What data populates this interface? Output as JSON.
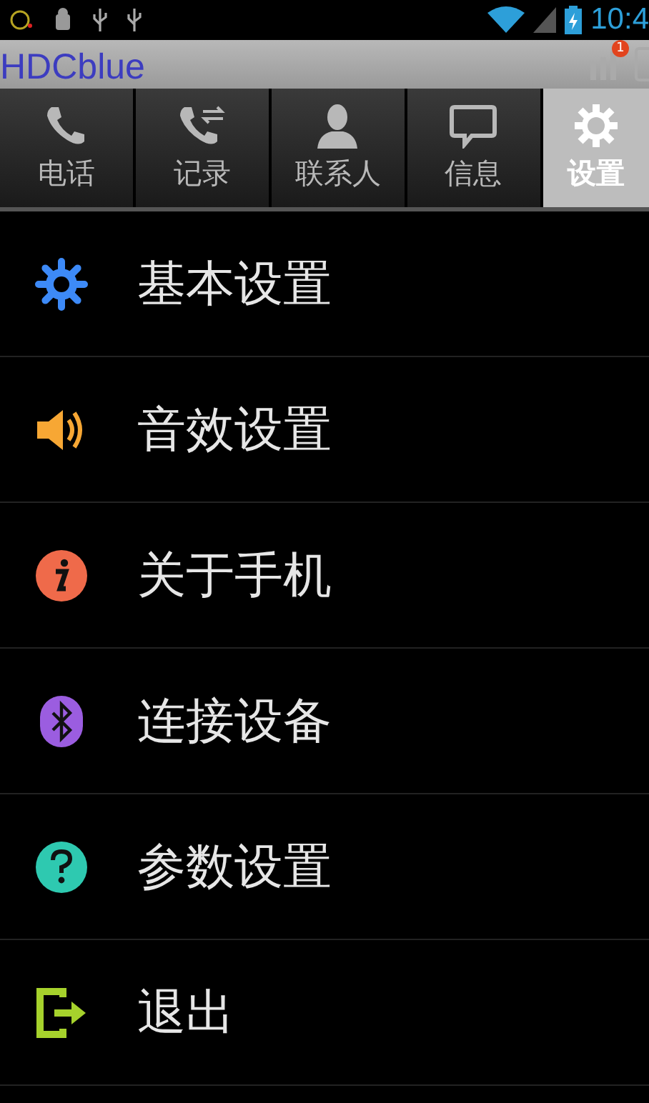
{
  "status_bar": {
    "time": "10:4"
  },
  "title_bar": {
    "title": "HDCblue",
    "badge": "1"
  },
  "tabs": [
    {
      "label": "电话",
      "selected": false
    },
    {
      "label": "记录",
      "selected": false
    },
    {
      "label": "联系人",
      "selected": false
    },
    {
      "label": "信息",
      "selected": false
    },
    {
      "label": "设置",
      "selected": true
    }
  ],
  "menu": [
    {
      "label": "基本设置",
      "color": "#3d8af7"
    },
    {
      "label": "音效设置",
      "color": "#f7a734"
    },
    {
      "label": "关于手机",
      "color": "#ef6a4a"
    },
    {
      "label": "连接设备",
      "color": "#9b5de0"
    },
    {
      "label": "参数设置",
      "color": "#2ec9b0"
    },
    {
      "label": "退出",
      "color": "#a6d22c"
    }
  ]
}
